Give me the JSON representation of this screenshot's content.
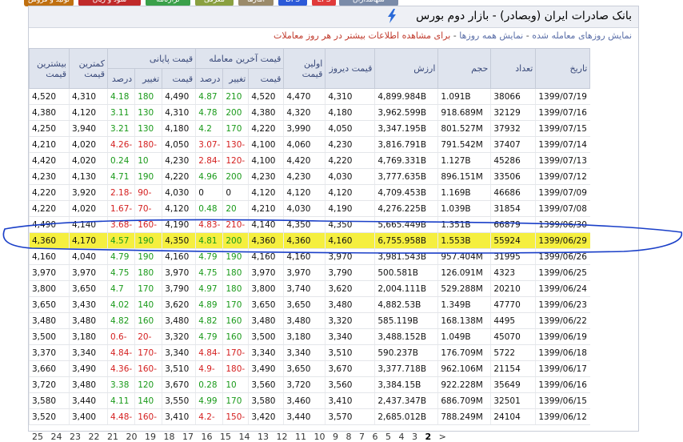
{
  "top_tabs": [
    {
      "label": "سهامداران",
      "color": "#7a8ba8"
    },
    {
      "label": "EPS",
      "color": "#e03a3a"
    },
    {
      "label": "DPS",
      "color": "#2c5ad8"
    },
    {
      "label": "آمارها",
      "color": "#9a8a6a"
    },
    {
      "label": "معرفی",
      "color": "#8aa040"
    },
    {
      "label": "ترازنامه",
      "color": "#3aa04a"
    },
    {
      "label": "سود و زیان",
      "color": "#c02a2a"
    },
    {
      "label": "تولید و فروش",
      "color": "#c07010"
    }
  ],
  "header": {
    "title": "بانک صادرات ایران (وبصادر) - بازار دوم بورس"
  },
  "subline": {
    "part1": "نمایش روزهای معامله شده",
    "sep1": " - ",
    "part2": "نمایش همه روزها",
    "sep2": " - ",
    "part3": "برای مشاهده اطلاعات بیشتر در هر روز معاملات"
  },
  "table": {
    "headers": {
      "date": "تاریخ",
      "count": "تعداد",
      "volume": "حجم",
      "value": "ارزش",
      "prev": "قیمت دیروز",
      "first": "اولین قیمت",
      "last_group": "قیمت آخرین معامله",
      "close_group": "قیمت پایانی",
      "low": "کمترین قیمت",
      "high": "بیشترین قیمت",
      "price": "قیمت",
      "change": "تغییر",
      "percent": "درصد"
    },
    "rows": [
      {
        "date": "1399/07/19",
        "count": "38066",
        "volume": "1.091B",
        "value": "4,899.984B",
        "prev": "4,310",
        "first": "4,470",
        "last": "4,520",
        "last_chg": "210",
        "last_pct": "4.87",
        "close": "4,490",
        "close_chg": "180",
        "close_pct": "4.18",
        "low": "4,310",
        "high": "4,520"
      },
      {
        "date": "1399/07/16",
        "count": "32129",
        "volume": "918.689M",
        "value": "3,962.599B",
        "prev": "4,180",
        "first": "4,320",
        "last": "4,380",
        "last_chg": "200",
        "last_pct": "4.78",
        "close": "4,310",
        "close_chg": "130",
        "close_pct": "3.11",
        "low": "4,120",
        "high": "4,380"
      },
      {
        "date": "1399/07/15",
        "count": "37932",
        "volume": "801.527M",
        "value": "3,347.195B",
        "prev": "4,050",
        "first": "3,990",
        "last": "4,220",
        "last_chg": "170",
        "last_pct": "4.2",
        "close": "4,180",
        "close_chg": "130",
        "close_pct": "3.21",
        "low": "3,940",
        "high": "4,250"
      },
      {
        "date": "1399/07/14",
        "count": "37407",
        "volume": "791.542M",
        "value": "3,816.791B",
        "prev": "4,230",
        "first": "4,060",
        "last": "4,100",
        "last_chg": "-130",
        "last_pct": "-3.07",
        "close": "4,050",
        "close_chg": "-180",
        "close_pct": "-4.26",
        "low": "4,020",
        "high": "4,210"
      },
      {
        "date": "1399/07/13",
        "count": "45286",
        "volume": "1.127B",
        "value": "4,769.331B",
        "prev": "4,220",
        "first": "4,420",
        "last": "4,100",
        "last_chg": "-120",
        "last_pct": "-2.84",
        "close": "4,230",
        "close_chg": "10",
        "close_pct": "0.24",
        "low": "4,020",
        "high": "4,420"
      },
      {
        "date": "1399/07/12",
        "count": "33506",
        "volume": "896.151M",
        "value": "3,777.635B",
        "prev": "4,030",
        "first": "4,230",
        "last": "4,230",
        "last_chg": "200",
        "last_pct": "4.96",
        "close": "4,220",
        "close_chg": "190",
        "close_pct": "4.71",
        "low": "4,130",
        "high": "4,230"
      },
      {
        "date": "1399/07/09",
        "count": "46686",
        "volume": "1.169B",
        "value": "4,709.453B",
        "prev": "4,120",
        "first": "4,120",
        "last": "4,120",
        "last_chg": "0",
        "last_pct": "0",
        "close": "4,030",
        "close_chg": "-90",
        "close_pct": "-2.18",
        "low": "3,920",
        "high": "4,220"
      },
      {
        "date": "1399/07/08",
        "count": "31854",
        "volume": "1.039B",
        "value": "4,276.225B",
        "prev": "4,190",
        "first": "4,030",
        "last": "4,210",
        "last_chg": "20",
        "last_pct": "0.48",
        "close": "4,120",
        "close_chg": "-70",
        "close_pct": "-1.67",
        "low": "4,020",
        "high": "4,220"
      },
      {
        "date": "1399/06/30",
        "count": "66879",
        "volume": "1.351B",
        "value": "5,665.449B",
        "prev": "4,350",
        "first": "4,350",
        "last": "4,140",
        "last_chg": "-210",
        "last_pct": "-4.83",
        "close": "4,190",
        "close_chg": "-160",
        "close_pct": "-3.68",
        "low": "4,140",
        "high": "4,490"
      },
      {
        "date": "1399/06/29",
        "count": "55924",
        "volume": "1.553B",
        "value": "6,755.958B",
        "prev": "4,160",
        "first": "4,360",
        "last": "4,360",
        "last_chg": "200",
        "last_pct": "4.81",
        "close": "4,350",
        "close_chg": "190",
        "close_pct": "4.57",
        "low": "4,170",
        "high": "4,360",
        "highlight": true
      },
      {
        "date": "1399/06/26",
        "count": "31995",
        "volume": "957.404M",
        "value": "3,981.543B",
        "prev": "3,970",
        "first": "4,160",
        "last": "4,160",
        "last_chg": "190",
        "last_pct": "4.79",
        "close": "4,160",
        "close_chg": "190",
        "close_pct": "4.79",
        "low": "4,040",
        "high": "4,160"
      },
      {
        "date": "1399/06/25",
        "count": "4323",
        "volume": "126.091M",
        "value": "500.581B",
        "prev": "3,790",
        "first": "3,970",
        "last": "3,970",
        "last_chg": "180",
        "last_pct": "4.75",
        "close": "3,970",
        "close_chg": "180",
        "close_pct": "4.75",
        "low": "3,970",
        "high": "3,970"
      },
      {
        "date": "1399/06/24",
        "count": "20210",
        "volume": "529.288M",
        "value": "2,004.111B",
        "prev": "3,620",
        "first": "3,740",
        "last": "3,800",
        "last_chg": "180",
        "last_pct": "4.97",
        "close": "3,790",
        "close_chg": "170",
        "close_pct": "4.7",
        "low": "3,650",
        "high": "3,800"
      },
      {
        "date": "1399/06/23",
        "count": "47770",
        "volume": "1.349B",
        "value": "4,882.53B",
        "prev": "3,480",
        "first": "3,650",
        "last": "3,650",
        "last_chg": "170",
        "last_pct": "4.89",
        "close": "3,620",
        "close_chg": "140",
        "close_pct": "4.02",
        "low": "3,430",
        "high": "3,650"
      },
      {
        "date": "1399/06/22",
        "count": "4495",
        "volume": "168.138M",
        "value": "585.119B",
        "prev": "3,320",
        "first": "3,480",
        "last": "3,480",
        "last_chg": "160",
        "last_pct": "4.82",
        "close": "3,480",
        "close_chg": "160",
        "close_pct": "4.82",
        "low": "3,480",
        "high": "3,480"
      },
      {
        "date": "1399/06/19",
        "count": "45070",
        "volume": "1.049B",
        "value": "3,488.152B",
        "prev": "3,340",
        "first": "3,180",
        "last": "3,500",
        "last_chg": "160",
        "last_pct": "4.79",
        "close": "3,320",
        "close_chg": "-20",
        "close_pct": "-0.6",
        "low": "3,180",
        "high": "3,500"
      },
      {
        "date": "1399/06/18",
        "count": "5722",
        "volume": "176.709M",
        "value": "590.237B",
        "prev": "3,510",
        "first": "3,340",
        "last": "3,340",
        "last_chg": "-170",
        "last_pct": "-4.84",
        "close": "3,340",
        "close_chg": "-170",
        "close_pct": "-4.84",
        "low": "3,340",
        "high": "3,370"
      },
      {
        "date": "1399/06/17",
        "count": "21154",
        "volume": "962.106M",
        "value": "3,377.718B",
        "prev": "3,670",
        "first": "3,650",
        "last": "3,490",
        "last_chg": "-180",
        "last_pct": "-4.9",
        "close": "3,510",
        "close_chg": "-160",
        "close_pct": "-4.36",
        "low": "3,490",
        "high": "3,660"
      },
      {
        "date": "1399/06/16",
        "count": "35649",
        "volume": "922.228M",
        "value": "3,384.15B",
        "prev": "3,560",
        "first": "3,720",
        "last": "3,560",
        "last_chg": "10",
        "last_pct": "0.28",
        "close": "3,670",
        "close_chg": "120",
        "close_pct": "3.38",
        "low": "3,480",
        "high": "3,720"
      },
      {
        "date": "1399/06/15",
        "count": "32501",
        "volume": "686.709M",
        "value": "2,437.347B",
        "prev": "3,410",
        "first": "3,460",
        "last": "3,580",
        "last_chg": "170",
        "last_pct": "4.99",
        "close": "3,550",
        "close_chg": "140",
        "close_pct": "4.11",
        "low": "3,440",
        "high": "3,580"
      },
      {
        "date": "1399/06/12",
        "count": "24104",
        "volume": "788.249M",
        "value": "2,685.012B",
        "prev": "3,570",
        "first": "3,440",
        "last": "3,420",
        "last_chg": "-150",
        "last_pct": "-4.2",
        "close": "3,410",
        "close_chg": "-160",
        "close_pct": "-4.48",
        "low": "3,400",
        "high": "3,520"
      }
    ]
  },
  "pager": {
    "pages": [
      "25",
      "24",
      "23",
      "22",
      "21",
      "20",
      "19",
      "18",
      "17",
      "16",
      "15",
      "14",
      "13",
      "12",
      "11",
      "10",
      "9",
      "8",
      "7",
      "6",
      "5",
      "4",
      "3"
    ],
    "current": "2",
    "next": ">"
  }
}
